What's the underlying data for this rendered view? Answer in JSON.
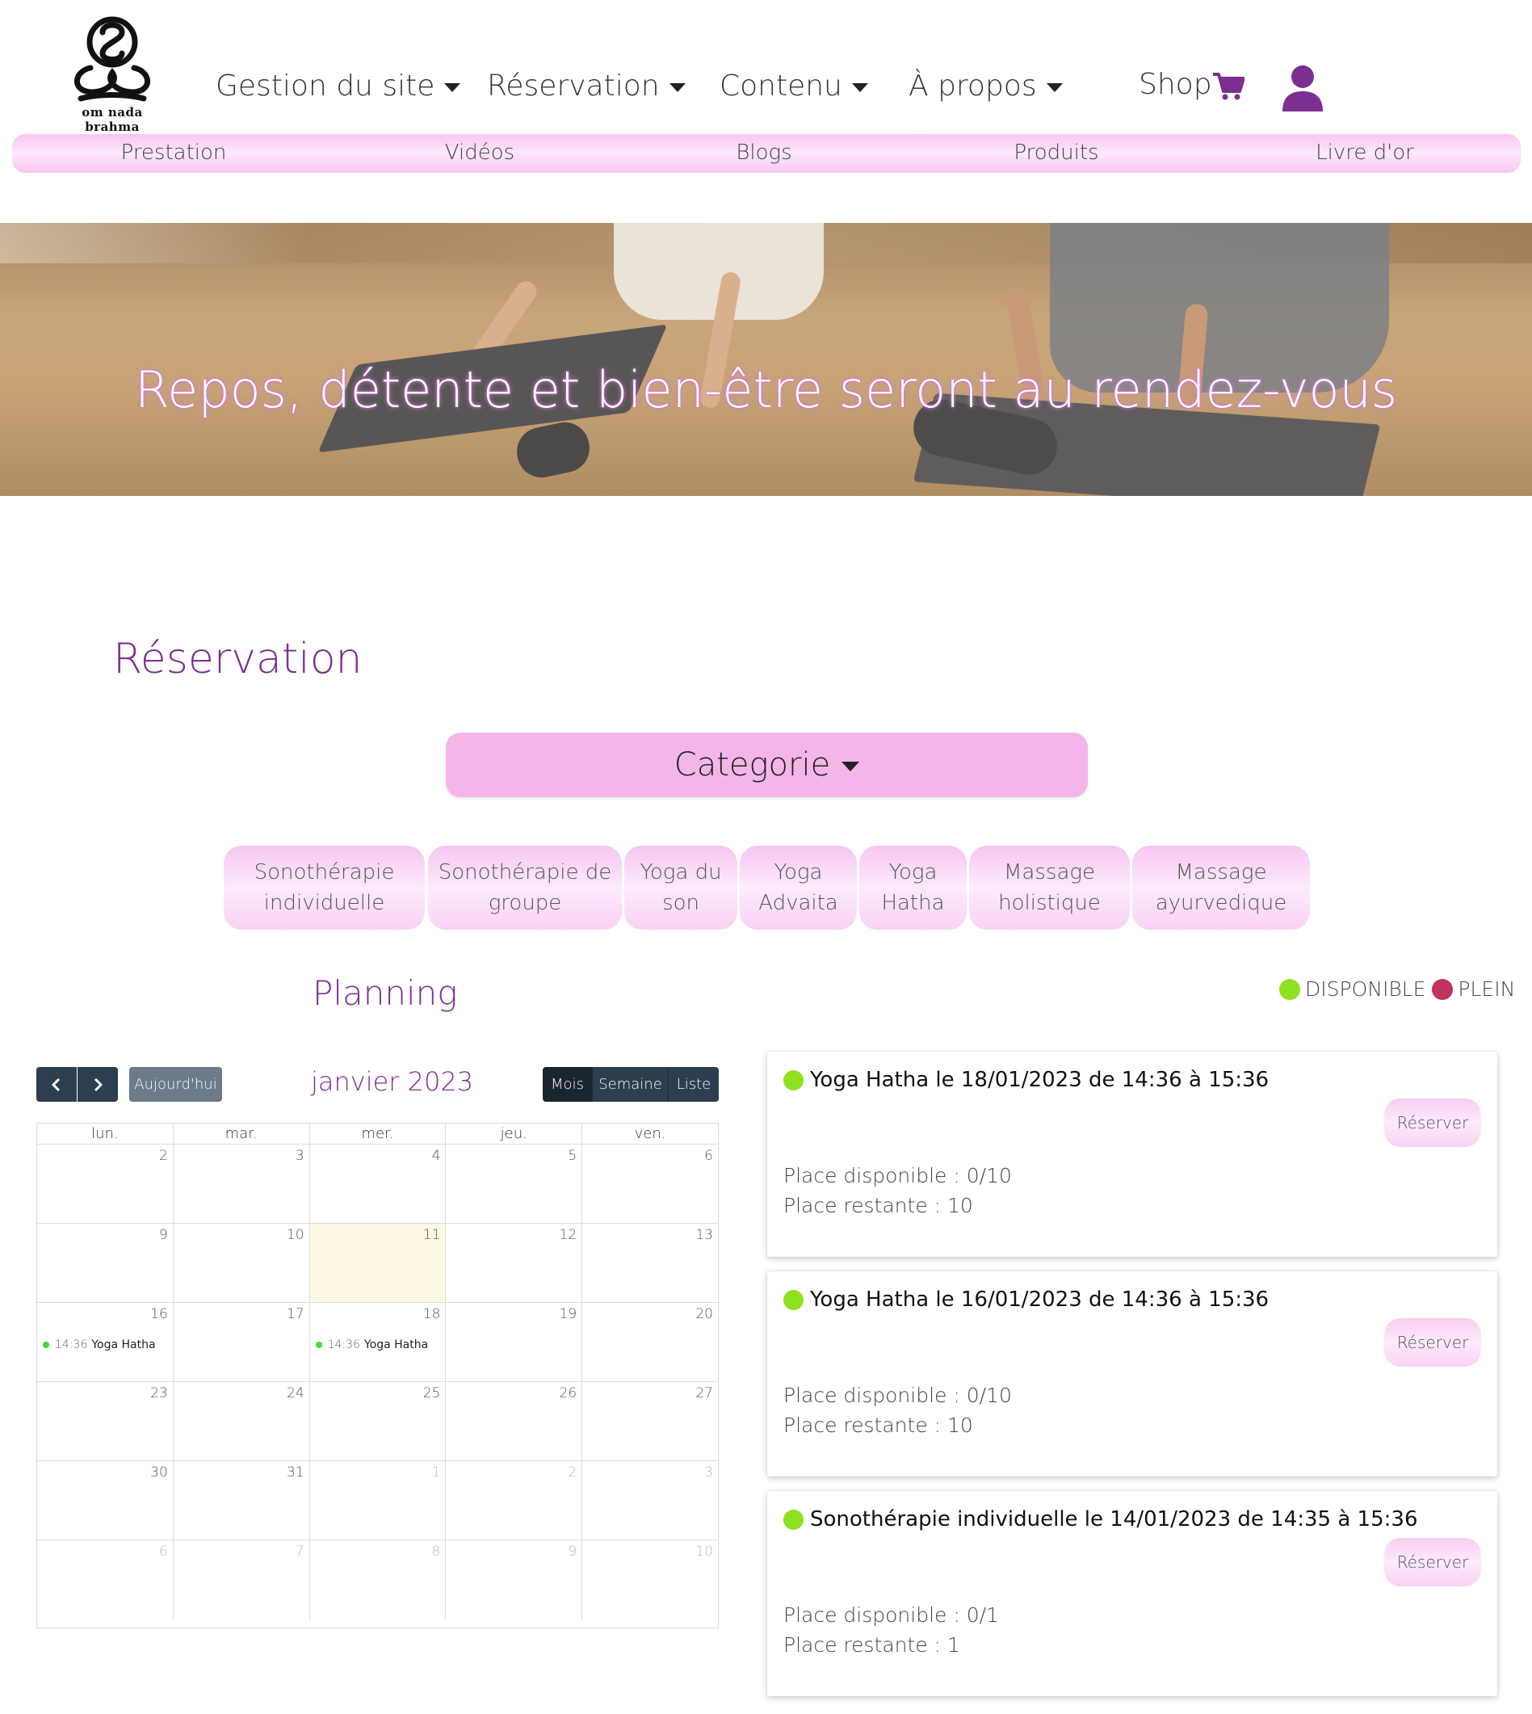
{
  "logo": {
    "text": "om nada brahma"
  },
  "nav": {
    "items": [
      "Gestion du site",
      "Réservation",
      "Contenu",
      "À propos"
    ],
    "shop": "Shop"
  },
  "subnav": [
    "Prestation",
    "Vidéos",
    "Blogs",
    "Produits",
    "Livre d'or"
  ],
  "hero": {
    "title": "Repos, détente et bien-être seront au rendez-vous"
  },
  "reservation": {
    "title": "Réservation",
    "category_button": "Categorie",
    "categories": [
      [
        "Sonothérapie",
        "individuelle"
      ],
      [
        "Sonothérapie de",
        "groupe"
      ],
      [
        "Yoga du",
        "son"
      ],
      [
        "Yoga",
        "Advaita"
      ],
      [
        "Yoga",
        "Hatha"
      ],
      [
        "Massage",
        "holistique"
      ],
      [
        "Massage",
        "ayurvedique"
      ]
    ]
  },
  "planning": {
    "title": "Planning",
    "legend": {
      "available": "DISPONIBLE",
      "full": "PLEIN",
      "available_color": "#8fe01f",
      "full_color": "#c0335a"
    }
  },
  "calendar": {
    "today_button": "Aujourd'hui",
    "month": "janvier 2023",
    "views": [
      "Mois",
      "Semaine",
      "Liste"
    ],
    "active_view": "Mois",
    "weekdays": [
      "lun.",
      "mar.",
      "mer.",
      "jeu.",
      "ven."
    ],
    "weeks": [
      [
        {
          "d": "2"
        },
        {
          "d": "3"
        },
        {
          "d": "4"
        },
        {
          "d": "5"
        },
        {
          "d": "6"
        }
      ],
      [
        {
          "d": "9"
        },
        {
          "d": "10"
        },
        {
          "d": "11",
          "today": true
        },
        {
          "d": "12"
        },
        {
          "d": "13"
        }
      ],
      [
        {
          "d": "16",
          "event": {
            "time": "14:36",
            "title": "Yoga Hatha"
          }
        },
        {
          "d": "17"
        },
        {
          "d": "18",
          "event": {
            "time": "14:36",
            "title": "Yoga Hatha"
          }
        },
        {
          "d": "19"
        },
        {
          "d": "20"
        }
      ],
      [
        {
          "d": "23"
        },
        {
          "d": "24"
        },
        {
          "d": "25"
        },
        {
          "d": "26"
        },
        {
          "d": "27"
        }
      ],
      [
        {
          "d": "30"
        },
        {
          "d": "31"
        },
        {
          "d": "1",
          "other": true
        },
        {
          "d": "2",
          "other": true
        },
        {
          "d": "3",
          "other": true
        }
      ],
      [
        {
          "d": "6",
          "other": true
        },
        {
          "d": "7",
          "other": true
        },
        {
          "d": "8",
          "other": true
        },
        {
          "d": "9",
          "other": true
        },
        {
          "d": "10",
          "other": true
        }
      ]
    ]
  },
  "sessions": [
    {
      "title": "Yoga Hatha le 18/01/2023 de 14:36 à 15:36",
      "button": "Réserver",
      "dispo": "Place disponible : 0/10",
      "restante": "Place restante : 10"
    },
    {
      "title": "Yoga Hatha le 16/01/2023 de 14:36 à 15:36",
      "button": "Réserver",
      "dispo": "Place disponible : 0/10",
      "restante": "Place restante : 10"
    },
    {
      "title": "Sonothérapie individuelle le 14/01/2023 de 14:35 à 15:36",
      "button": "Réserver",
      "dispo": "Place disponible : 0/1",
      "restante": "Place restante : 1"
    }
  ]
}
